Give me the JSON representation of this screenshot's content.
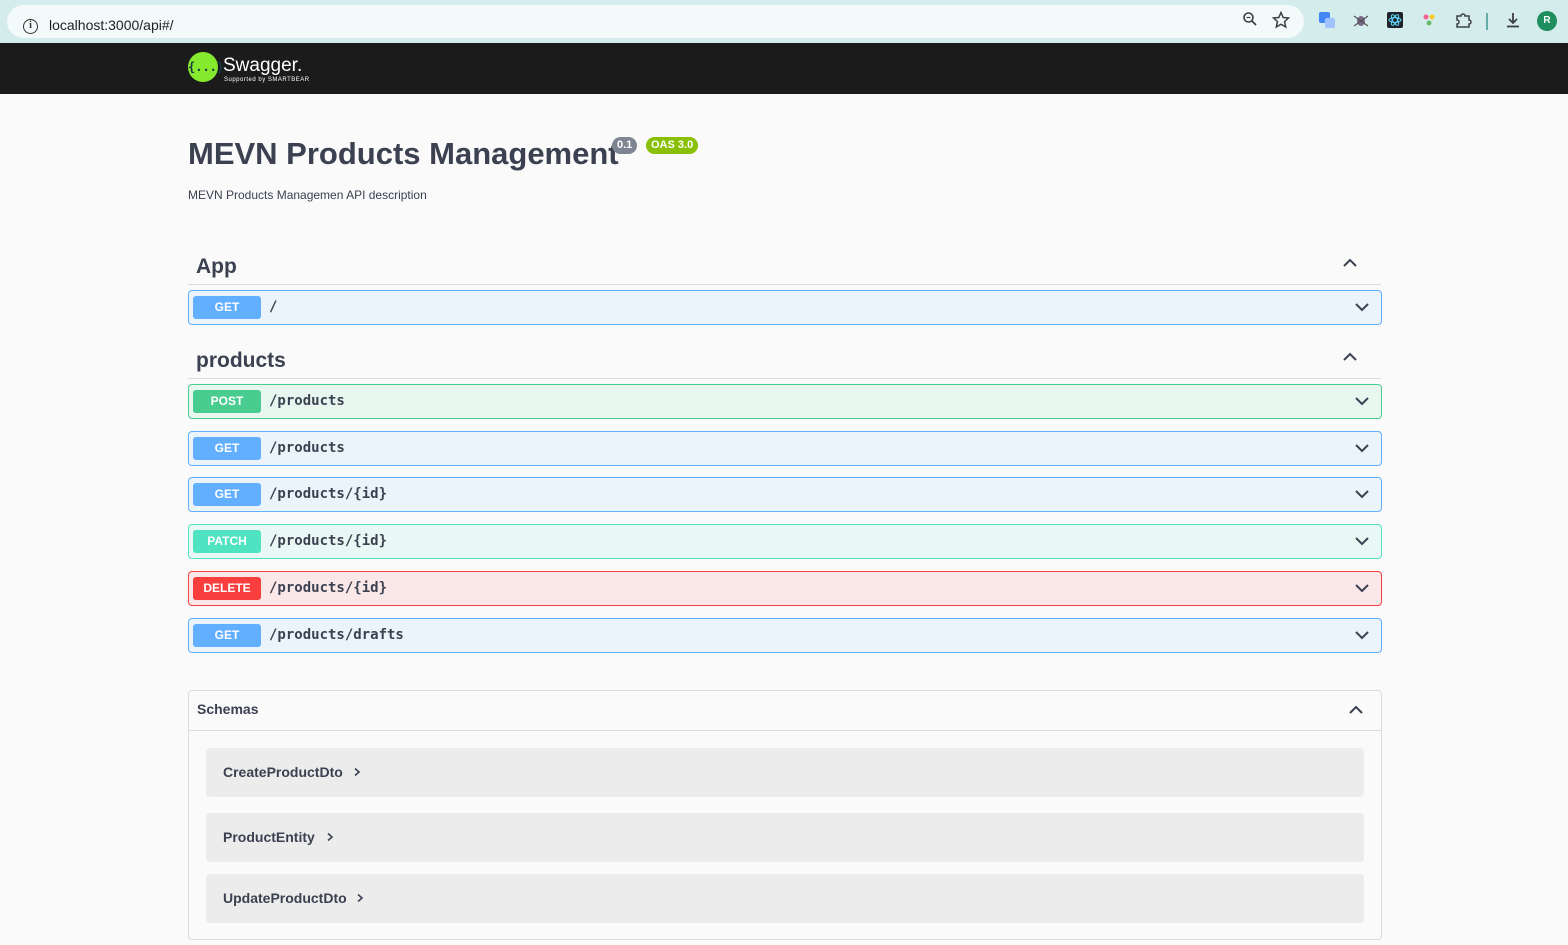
{
  "browser": {
    "url": "localhost:3000/api#/",
    "profile_initial": "R",
    "icons": [
      "info-icon",
      "zoom-icon",
      "bookmark-star-icon",
      "translate-extension-icon",
      "bug-extension-icon",
      "react-devtools-icon",
      "color-extension-icon",
      "extensions-puzzle-icon",
      "download-icon"
    ]
  },
  "topbar": {
    "logo_glyph": "{...}",
    "logo_text": "Swagger.",
    "logo_sub": "Supported by SMARTBEAR"
  },
  "info": {
    "title": "MEVN Products Management",
    "version": "0.1",
    "oas": "OAS 3.0",
    "description": "MEVN Products Managemen API description"
  },
  "tags": [
    {
      "name": "App",
      "operations": [
        {
          "method": "GET",
          "path": "/"
        }
      ]
    },
    {
      "name": "products",
      "operations": [
        {
          "method": "POST",
          "path": "/products"
        },
        {
          "method": "GET",
          "path": "/products"
        },
        {
          "method": "GET",
          "path": "/products/{id}"
        },
        {
          "method": "PATCH",
          "path": "/products/{id}"
        },
        {
          "method": "DELETE",
          "path": "/products/{id}"
        },
        {
          "method": "GET",
          "path": "/products/drafts"
        }
      ]
    }
  ],
  "schemas": {
    "title": "Schemas",
    "models": [
      "CreateProductDto",
      "ProductEntity",
      "UpdateProductDto"
    ]
  },
  "colors": {
    "get": "#61affe",
    "post": "#49cc90",
    "patch": "#50e3c2",
    "delete": "#f93e3e",
    "swagger_green": "#85ea2d",
    "topbar": "#1b1b1b"
  }
}
